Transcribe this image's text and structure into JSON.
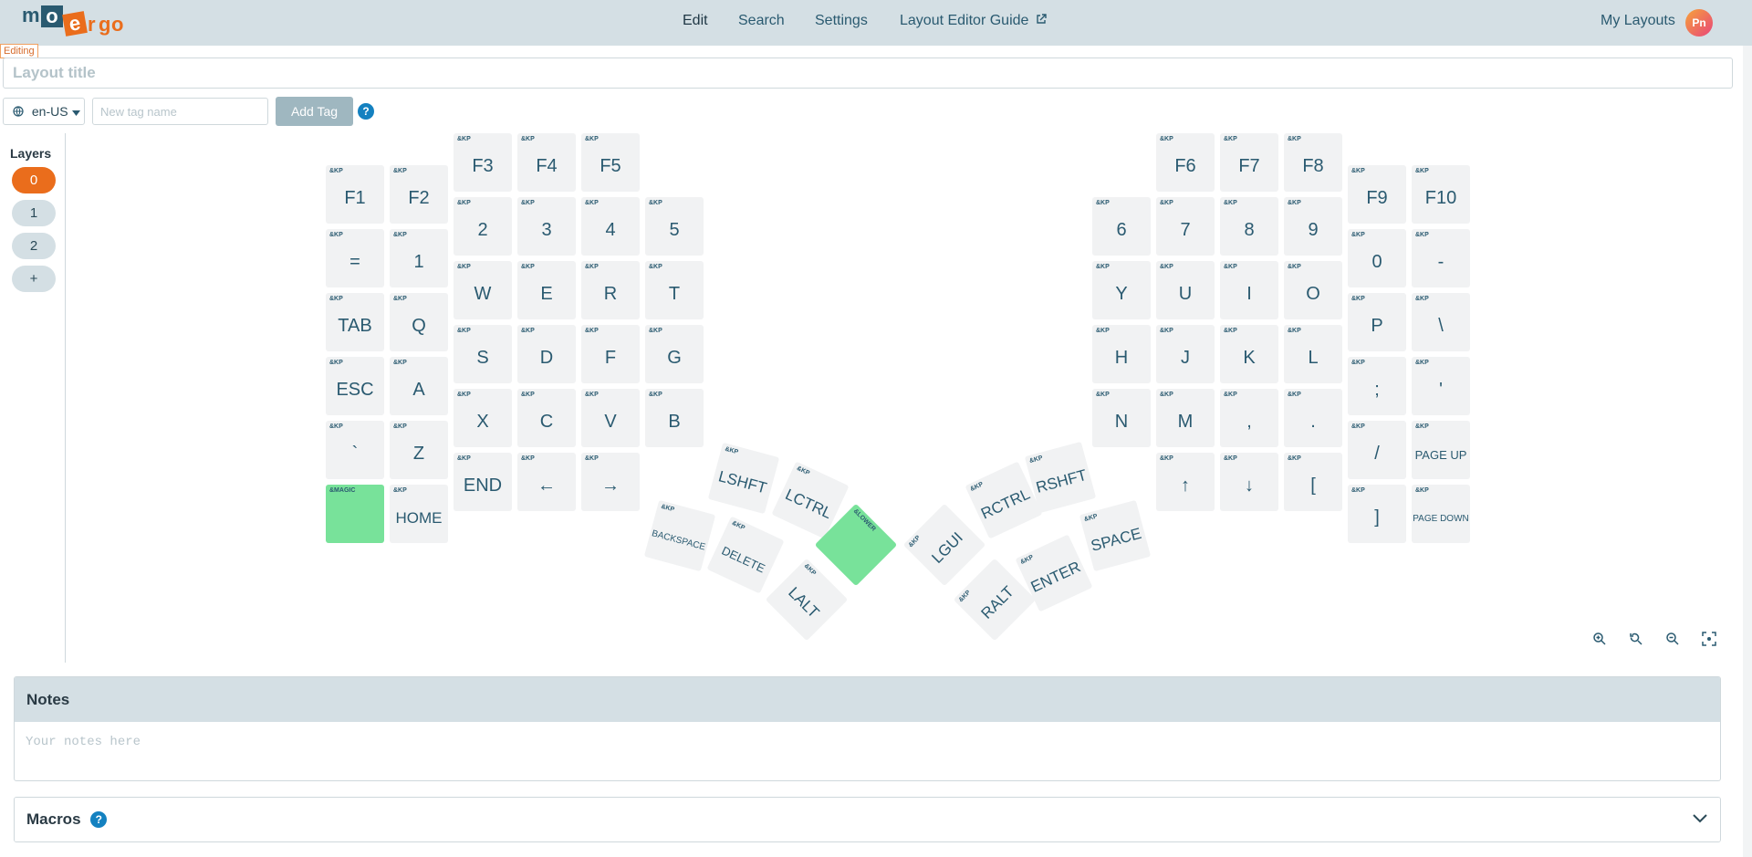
{
  "brand": {
    "logo_letters": [
      "m",
      "o",
      "e",
      "r",
      "g",
      "o"
    ]
  },
  "nav": {
    "edit": "Edit",
    "search": "Search",
    "settings": "Settings",
    "guide": "Layout Editor Guide",
    "my_layouts": "My Layouts",
    "avatar_initials": "Pn"
  },
  "editor": {
    "status": "Editing",
    "title_placeholder": "Layout title",
    "locale": "en-US",
    "tag_placeholder": "New tag name",
    "add_tag": "Add Tag",
    "help": "?"
  },
  "layers": {
    "title": "Layers",
    "items": [
      "0",
      "1",
      "2",
      "+"
    ],
    "active": "0"
  },
  "keys": [
    {
      "kp": "&KP",
      "label": "F1"
    },
    {
      "kp": "&KP",
      "label": "F2"
    },
    {
      "kp": "&KP",
      "label": "F3"
    },
    {
      "kp": "&KP",
      "label": "F4"
    },
    {
      "kp": "&KP",
      "label": "F5"
    },
    {
      "kp": "&KP",
      "label": "="
    },
    {
      "kp": "&KP",
      "label": "1"
    },
    {
      "kp": "&KP",
      "label": "2"
    },
    {
      "kp": "&KP",
      "label": "3"
    },
    {
      "kp": "&KP",
      "label": "4"
    },
    {
      "kp": "&KP",
      "label": "5"
    },
    {
      "kp": "&KP",
      "label": "TAB"
    },
    {
      "kp": "&KP",
      "label": "Q"
    },
    {
      "kp": "&KP",
      "label": "W"
    },
    {
      "kp": "&KP",
      "label": "E"
    },
    {
      "kp": "&KP",
      "label": "R"
    },
    {
      "kp": "&KP",
      "label": "T"
    },
    {
      "kp": "&KP",
      "label": "ESC"
    },
    {
      "kp": "&KP",
      "label": "A"
    },
    {
      "kp": "&KP",
      "label": "S"
    },
    {
      "kp": "&KP",
      "label": "D"
    },
    {
      "kp": "&KP",
      "label": "F"
    },
    {
      "kp": "&KP",
      "label": "G"
    },
    {
      "kp": "&KP",
      "label": "`"
    },
    {
      "kp": "&KP",
      "label": "Z"
    },
    {
      "kp": "&KP",
      "label": "X"
    },
    {
      "kp": "&KP",
      "label": "C"
    },
    {
      "kp": "&KP",
      "label": "V"
    },
    {
      "kp": "&KP",
      "label": "B"
    },
    {
      "kp": "&MAGIC",
      "label": ""
    },
    {
      "kp": "&KP",
      "label": "HOME"
    },
    {
      "kp": "&KP",
      "label": "END"
    },
    {
      "kp": "&KP",
      "label": "←"
    },
    {
      "kp": "&KP",
      "label": "→"
    },
    {
      "kp": "&KP",
      "label": "LSHFT"
    },
    {
      "kp": "&KP",
      "label": "LCTRL"
    },
    {
      "kp": "&LOWER",
      "label": ""
    },
    {
      "kp": "&KP",
      "label": "BACKSPACE"
    },
    {
      "kp": "&KP",
      "label": "DELETE"
    },
    {
      "kp": "&KP",
      "label": "LALT"
    },
    {
      "kp": "&KP",
      "label": "F6"
    },
    {
      "kp": "&KP",
      "label": "F7"
    },
    {
      "kp": "&KP",
      "label": "F8"
    },
    {
      "kp": "&KP",
      "label": "F9"
    },
    {
      "kp": "&KP",
      "label": "F10"
    },
    {
      "kp": "&KP",
      "label": "6"
    },
    {
      "kp": "&KP",
      "label": "7"
    },
    {
      "kp": "&KP",
      "label": "8"
    },
    {
      "kp": "&KP",
      "label": "9"
    },
    {
      "kp": "&KP",
      "label": "0"
    },
    {
      "kp": "&KP",
      "label": "-"
    },
    {
      "kp": "&KP",
      "label": "Y"
    },
    {
      "kp": "&KP",
      "label": "U"
    },
    {
      "kp": "&KP",
      "label": "I"
    },
    {
      "kp": "&KP",
      "label": "O"
    },
    {
      "kp": "&KP",
      "label": "P"
    },
    {
      "kp": "&KP",
      "label": "\\"
    },
    {
      "kp": "&KP",
      "label": "H"
    },
    {
      "kp": "&KP",
      "label": "J"
    },
    {
      "kp": "&KP",
      "label": "K"
    },
    {
      "kp": "&KP",
      "label": "L"
    },
    {
      "kp": "&KP",
      "label": ";"
    },
    {
      "kp": "&KP",
      "label": "'"
    },
    {
      "kp": "&KP",
      "label": "N"
    },
    {
      "kp": "&KP",
      "label": "M"
    },
    {
      "kp": "&KP",
      "label": ","
    },
    {
      "kp": "&KP",
      "label": "."
    },
    {
      "kp": "&KP",
      "label": "/"
    },
    {
      "kp": "&KP",
      "label": "PAGE UP"
    },
    {
      "kp": "&KP",
      "label": "↑"
    },
    {
      "kp": "&KP",
      "label": "↓"
    },
    {
      "kp": "&KP",
      "label": "["
    },
    {
      "kp": "&KP",
      "label": "]"
    },
    {
      "kp": "&KP",
      "label": "PAGE DOWN"
    },
    {
      "kp": "&KP",
      "label": "LGUI"
    },
    {
      "kp": "&KP",
      "label": "RCTRL"
    },
    {
      "kp": "&KP",
      "label": "RSHFT"
    },
    {
      "kp": "&KP",
      "label": "ENTER"
    },
    {
      "kp": "&KP",
      "label": "SPACE"
    },
    {
      "kp": "&KP",
      "label": "RALT"
    }
  ],
  "zoom_icons": [
    "zoom-in-icon",
    "zoom-reset-icon",
    "zoom-out-icon",
    "fit-screen-icon"
  ],
  "notes": {
    "title": "Notes",
    "placeholder": "Your notes here"
  },
  "macros": {
    "title": "Macros",
    "help": "?"
  },
  "colors": {
    "accent": "#ea6d1c",
    "topbar": "#d4dfe4",
    "key": "#f1f2f3",
    "key_special": "#78e29a",
    "help": "#1481c0"
  }
}
